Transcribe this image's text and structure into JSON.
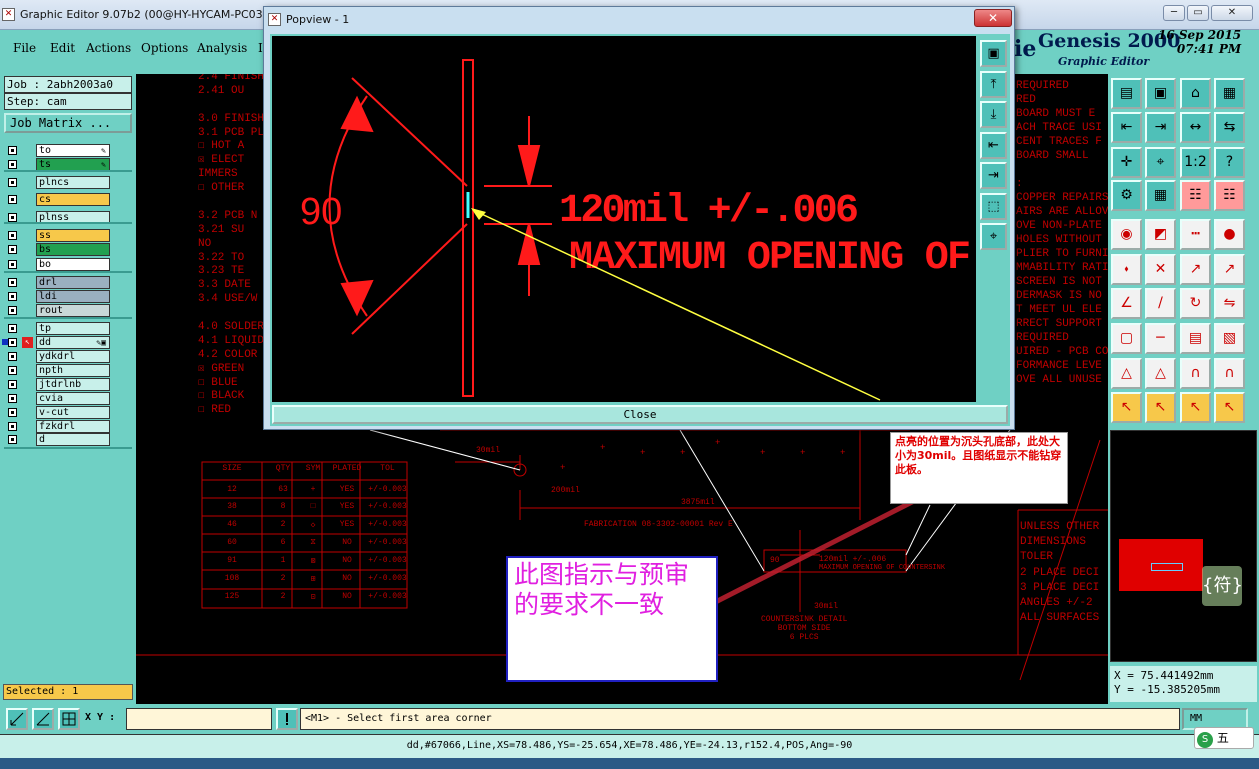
{
  "window": {
    "title": "Graphic Editor 9.07b2 (00@HY-HYCAM-PC030 -",
    "minimize": "─",
    "restore": "▭",
    "close": "✕"
  },
  "menu": [
    "File",
    "Edit",
    "Actions",
    "Options",
    "Analysis",
    "I"
  ],
  "brand": {
    "name": "Genesis 2000",
    "sub": "Graphic Editor",
    "date": "16 Sep 2015",
    "time": "07:41 PM",
    "fragment": "ie"
  },
  "job": {
    "job_label": "Job : 2abh2003a0",
    "step_label": "Step: cam",
    "matrix_button": "Job Matrix ..."
  },
  "layers": [
    {
      "name": "to",
      "color": "#ffffff",
      "sym": "✎"
    },
    {
      "name": "ts",
      "color": "#22a050",
      "sym": "✎"
    },
    {
      "name": "plncs",
      "color": "#c8f0ea",
      "sym": ""
    },
    {
      "name": "cs",
      "color": "#f7c84a",
      "sym": ""
    },
    {
      "name": "plnss",
      "color": "#c8f0ea",
      "sym": ""
    },
    {
      "name": "ss",
      "color": "#f7c84a",
      "sym": ""
    },
    {
      "name": "bs",
      "color": "#22a050",
      "sym": ""
    },
    {
      "name": "bo",
      "color": "#ffffff",
      "sym": ""
    },
    {
      "name": "drl",
      "color": "#9ab0c0",
      "sym": ""
    },
    {
      "name": "ldi",
      "color": "#9ab0c0",
      "sym": ""
    },
    {
      "name": "rout",
      "color": "#c8d8d8",
      "sym": ""
    },
    {
      "name": "tp",
      "color": "#c8f0ea",
      "sym": ""
    },
    {
      "name": "dd",
      "color": "#c8f0ea",
      "sym": "✎▣"
    },
    {
      "name": "ydkdrl",
      "color": "#c8f0ea",
      "sym": ""
    },
    {
      "name": "npth",
      "color": "#c8f0ea",
      "sym": ""
    },
    {
      "name": "jtdrlnb",
      "color": "#c8f0ea",
      "sym": ""
    },
    {
      "name": "cvia",
      "color": "#c8f0ea",
      "sym": ""
    },
    {
      "name": "v-cut",
      "color": "#c8f0ea",
      "sym": ""
    },
    {
      "name": "fzkdrl",
      "color": "#c8f0ea",
      "sym": ""
    },
    {
      "name": "d",
      "color": "#c8f0ea",
      "sym": ""
    }
  ],
  "selected": "Selected : 1",
  "coords": {
    "x": "X = 75.441492mm",
    "y": "Y = -15.385205mm"
  },
  "xy_label": "X Y :",
  "xy_value": "",
  "prompt": "<M1> - Select first area corner",
  "units": "MM",
  "status": "dd,#67066,Line,XS=78.486,YS=-25.654,XE=78.486,YE=-24.13,r152.4,POS,Ang=-90",
  "popup": {
    "title": "Popview - 1",
    "close_label": "Close",
    "angle": "90",
    "dim_text": "120mil +/-.006",
    "max_text": "MAXIMUM OPENING OF"
  },
  "notes": {
    "cn_red": "点亮的位置为沉头孔底部，此处大小为30mil。且图纸显示不能钻穿此板。",
    "cn_big": "此图指示与预审的要求不一致"
  },
  "drawing": {
    "left_text": [
      "2.4 FINISH",
      "2.41 OU",
      "",
      "3.0 FINISH:",
      "3.1 PCB PL",
      "☐ HOT A",
      "☒ ELECT",
      "IMMERS",
      "☐ OTHER",
      "",
      "3.2 PCB N",
      "3.21 SU",
      "NO",
      "3.22 TO",
      "3.23 TE",
      "3.3 DATE",
      "3.4 USE/W",
      "",
      "4.0 SOLDERMA",
      "4.1 LIQUID",
      "4.2 COLOR",
      "☒ GREEN",
      "☐ BLUE",
      "☐ BLACK",
      "☐ RED"
    ],
    "right_text": [
      "REQUIRED",
      "RED",
      "BOARD MUST E",
      "ACH TRACE USI",
      "CENT TRACES F",
      "BOARD SMALL",
      "",
      ":",
      "COPPER REPAIRS",
      "AIRS ARE ALLOV",
      "OVE NON-PLATE",
      "HOLES WITHOUT",
      "PLIER TO FURNI",
      "MMABILITY RATI",
      "SCREEN IS NOT",
      "DERMASK IS NO",
      "T MEET UL ELE",
      "RRECT SUPPORT",
      "REQUIRED",
      "UIRED - PCB CO",
      "FORMANCE LEVE",
      "OVE ALL UNUSE"
    ],
    "table_headers": [
      "SIZE",
      "QTY",
      "SYM",
      "PLATED",
      "TOL"
    ],
    "table_rows": [
      [
        "12",
        "63",
        "+",
        "YES",
        "+/-0.003"
      ],
      [
        "38",
        "8",
        "□",
        "YES",
        "+/-0.003"
      ],
      [
        "46",
        "2",
        "◇",
        "YES",
        "+/-0.003"
      ],
      [
        "60",
        "6",
        "⧖",
        "NO",
        "+/-0.003"
      ],
      [
        "91",
        "1",
        "⊠",
        "NO",
        "+/-0.003"
      ],
      [
        "108",
        "2",
        "⊞",
        "NO",
        "+/-0.003"
      ],
      [
        "125",
        "2",
        "⊡",
        "NO",
        "+/-0.003"
      ]
    ],
    "dim_30": "30mil",
    "dim_200": "200mil",
    "dim_3875": "3875mil",
    "fab_text": "FABRICATION    08-3302-00001 Rev E",
    "small_dim": "120mil +/-.006",
    "small_max": "MAXIMUM OPENING OF COUNTERSINK",
    "small_angle": "90",
    "detail1": "COUNTERSINK DETAIL",
    "detail2": "BOTTOM SIDE",
    "detail3": "6 PLCS",
    "small_30": "30mil",
    "unless": [
      "UNLESS OTHER",
      "DIMENSIONS",
      "TOLER",
      "2 PLACE DECI",
      "3 PLACE DECI",
      "ANGLES +/-2",
      "ALL SURFACES"
    ]
  },
  "fu_icon": "{符}",
  "ime": {
    "s": "S",
    "text": "五"
  },
  "colors": {
    "panel": "#6fd0c4",
    "accent": "#f7c84a",
    "drawing": "#e00000"
  }
}
